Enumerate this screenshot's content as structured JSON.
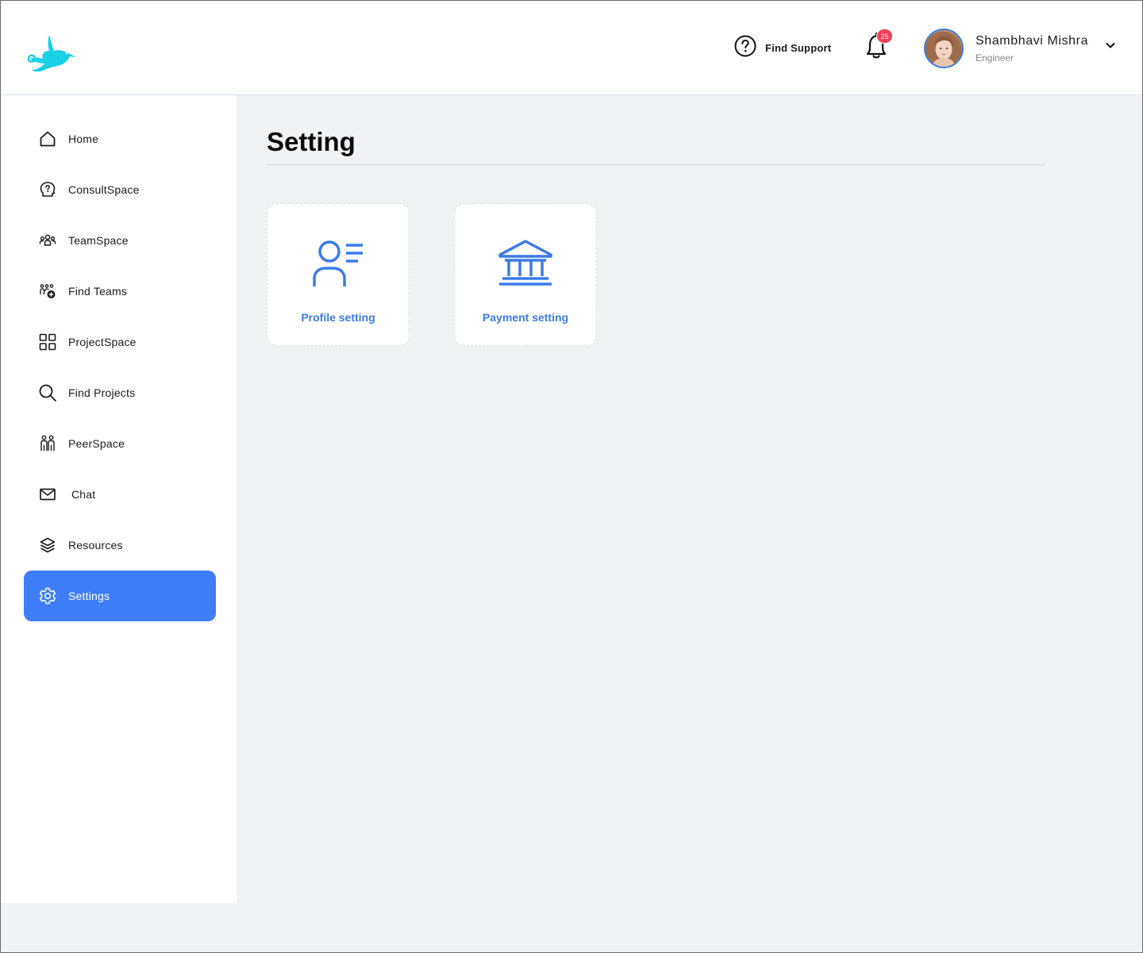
{
  "header": {
    "find_support_label": "Find Support",
    "notification_count": "25",
    "user": {
      "name": "Shambhavi Mishra",
      "role": "Engineer"
    }
  },
  "sidebar": {
    "items": [
      {
        "label": "Home",
        "icon": "home-icon"
      },
      {
        "label": "ConsultSpace",
        "icon": "consult-icon"
      },
      {
        "label": "TeamSpace",
        "icon": "team-icon"
      },
      {
        "label": "Find Teams",
        "icon": "find-teams-icon"
      },
      {
        "label": "ProjectSpace",
        "icon": "grid-icon"
      },
      {
        "label": "Find Projects",
        "icon": "search-icon"
      },
      {
        "label": "PeerSpace",
        "icon": "peers-icon"
      },
      {
        "label": "Chat",
        "icon": "mail-icon"
      },
      {
        "label": "Resources",
        "icon": "layers-icon"
      },
      {
        "label": "Settings",
        "icon": "gear-icon",
        "active": true
      }
    ]
  },
  "main": {
    "title": "Setting",
    "cards": [
      {
        "label": "Profile setting",
        "icon": "profile-list-icon"
      },
      {
        "label": "Payment setting",
        "icon": "bank-icon"
      }
    ]
  },
  "colors": {
    "accent": "#3f7ef8",
    "card_text": "#3b7be8",
    "logo": "#1ad0e4",
    "badge": "#f0405c"
  }
}
